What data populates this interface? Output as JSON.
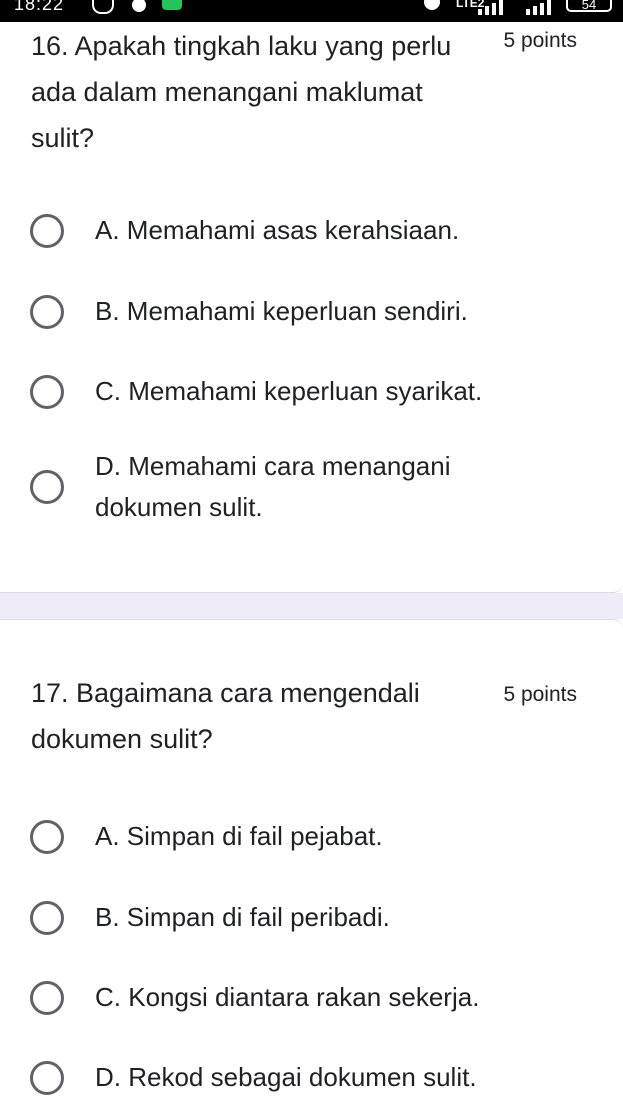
{
  "status_bar": {
    "time": "18:22",
    "network": "LTE2",
    "battery": "54"
  },
  "questions": [
    {
      "title": "16. Apakah tingkah laku yang perlu ada dalam menangani maklumat sulit?",
      "points": "5 points",
      "options": [
        "A. Memahami asas kerahsiaan.",
        "B. Memahami keperluan sendiri.",
        "C. Memahami keperluan syarikat.",
        "D. Memahami cara menangani dokumen sulit."
      ]
    },
    {
      "title": "17. Bagaimana cara mengendali dokumen sulit?",
      "points": "5 points",
      "options": [
        "A. Simpan di fail pejabat.",
        "B. Simpan di fail peribadi.",
        "C. Kongsi diantara rakan sekerja.",
        "D. Rekod sebagai dokumen sulit."
      ]
    }
  ],
  "colors": {
    "background": "#ffffff",
    "section_gap": "#f0ebf8",
    "radio_border": "#5f6368",
    "text": "#202124"
  }
}
